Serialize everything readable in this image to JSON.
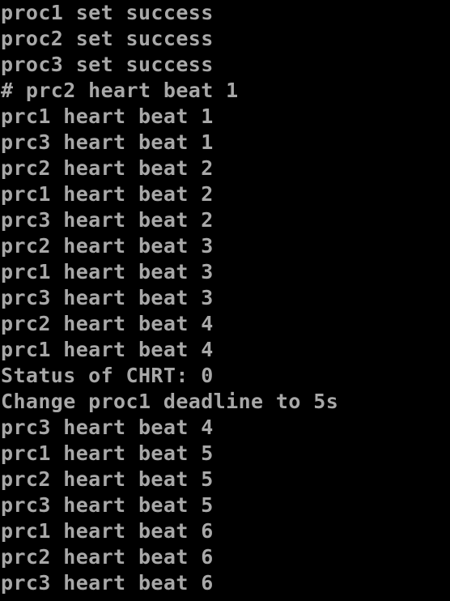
{
  "terminal": {
    "colors": {
      "background": "#000000",
      "text": "#a8a8a8"
    },
    "lines": [
      "proc1 set success",
      "proc2 set success",
      "proc3 set success",
      "# prc2 heart beat 1",
      "prc1 heart beat 1",
      "prc3 heart beat 1",
      "prc2 heart beat 2",
      "prc1 heart beat 2",
      "prc3 heart beat 2",
      "prc2 heart beat 3",
      "prc1 heart beat 3",
      "prc3 heart beat 3",
      "prc2 heart beat 4",
      "prc1 heart beat 4",
      "Status of CHRT: 0",
      "Change proc1 deadline to 5s",
      "prc3 heart beat 4",
      "prc1 heart beat 5",
      "prc2 heart beat 5",
      "prc3 heart beat 5",
      "prc1 heart beat 6",
      "prc2 heart beat 6",
      "prc3 heart beat 6"
    ]
  }
}
